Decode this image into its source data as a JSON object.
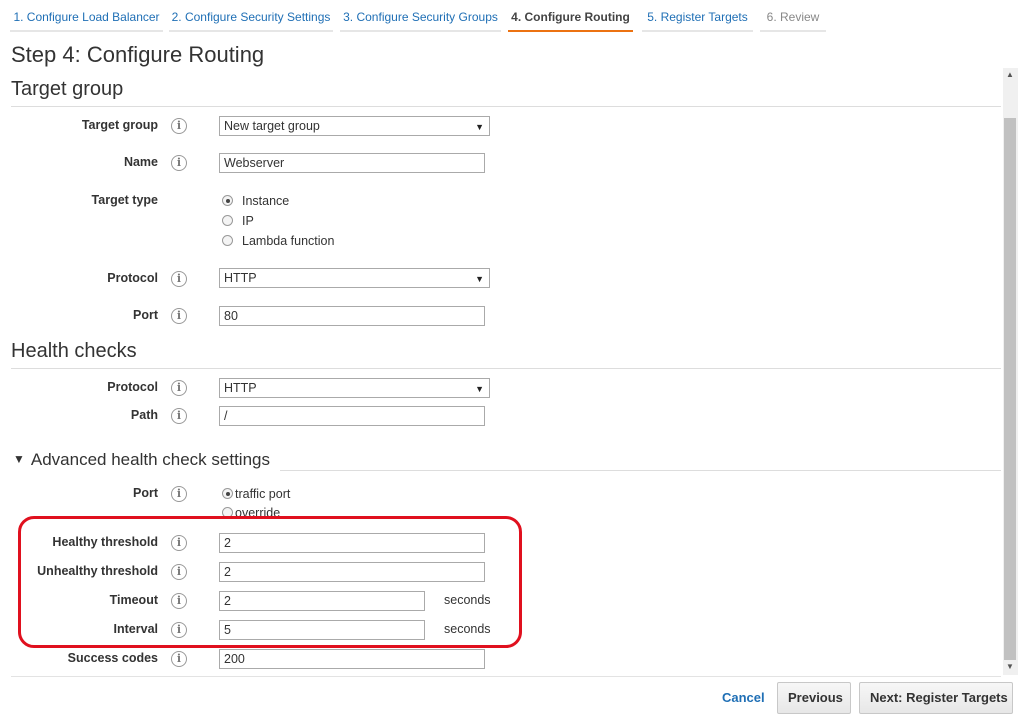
{
  "tabs": [
    {
      "label": "1. Configure Load Balancer",
      "state": "link"
    },
    {
      "label": "2. Configure Security Settings",
      "state": "link"
    },
    {
      "label": "3. Configure Security Groups",
      "state": "link"
    },
    {
      "label": "4. Configure Routing",
      "state": "active"
    },
    {
      "label": "5. Register Targets",
      "state": "link"
    },
    {
      "label": "6. Review",
      "state": "disabled"
    }
  ],
  "page": {
    "title": "Step 4: Configure Routing"
  },
  "target_group": {
    "section_title": "Target group",
    "target_group_label": "Target group",
    "target_group_value": "New target group",
    "name_label": "Name",
    "name_value": "Webserver",
    "target_type_label": "Target type",
    "target_type_options": [
      "Instance",
      "IP",
      "Lambda function"
    ],
    "target_type_selected": "Instance",
    "protocol_label": "Protocol",
    "protocol_value": "HTTP",
    "port_label": "Port",
    "port_value": "80"
  },
  "health_checks": {
    "section_title": "Health checks",
    "protocol_label": "Protocol",
    "protocol_value": "HTTP",
    "path_label": "Path",
    "path_value": "/"
  },
  "advanced": {
    "section_title": "Advanced health check settings",
    "expander_icon": "caret-down-icon",
    "port_label": "Port",
    "port_options": [
      "traffic port",
      "override"
    ],
    "port_selected": "traffic port",
    "healthy_threshold_label": "Healthy threshold",
    "healthy_threshold_value": "2",
    "unhealthy_threshold_label": "Unhealthy threshold",
    "unhealthy_threshold_value": "2",
    "timeout_label": "Timeout",
    "timeout_value": "2",
    "timeout_unit": "seconds",
    "interval_label": "Interval",
    "interval_value": "5",
    "interval_unit": "seconds",
    "success_codes_label": "Success codes",
    "success_codes_value": "200"
  },
  "info_icon_glyph": "i",
  "footer": {
    "cancel_label": "Cancel",
    "previous_label": "Previous",
    "next_label": "Next: Register Targets"
  },
  "colors": {
    "link": "#1f6fb5",
    "active_tab_underline": "#ec7211",
    "highlight_outline": "#e0101e"
  }
}
